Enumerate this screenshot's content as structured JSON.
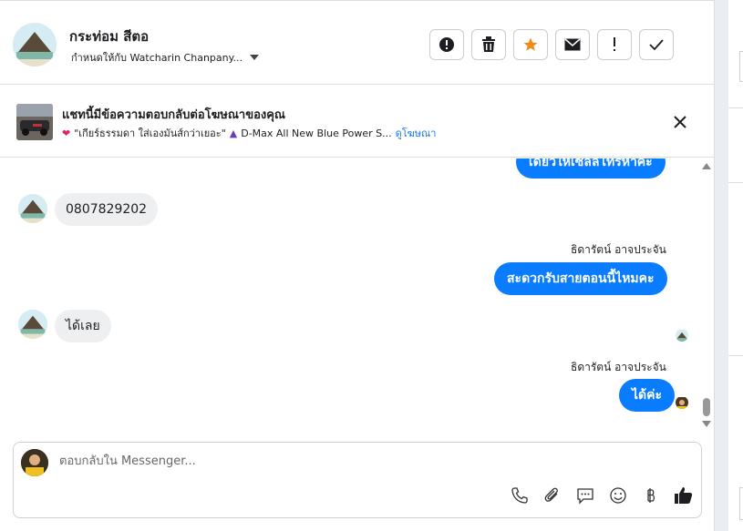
{
  "contact": {
    "name": "กระท่อม สีตอ",
    "assigned": "กำหนดให้กับ Watcharin Chanpany..."
  },
  "toolbar": {
    "buttons": [
      {
        "name": "spam-button",
        "icon": "alert-circle-icon"
      },
      {
        "name": "delete-button",
        "icon": "trash-icon"
      },
      {
        "name": "star-button",
        "icon": "star-icon",
        "color": "#f28a1b"
      },
      {
        "name": "mark-unread-button",
        "icon": "envelope-icon"
      },
      {
        "name": "follow-up-button",
        "icon": "exclamation-icon"
      },
      {
        "name": "done-button",
        "icon": "check-icon"
      }
    ]
  },
  "ad": {
    "title": "แชทนี้มีข้อความตอบกลับต่อโฆษณาของคุณ",
    "snippet": "\"เกียร์ธรรมดา ใส่เองมันส์กว่าเยอะ\"",
    "product": "D-Max All New Blue Power S...",
    "link": "ดูโฆษณา"
  },
  "messages": {
    "out_top": "เดี๋ยวให้เซลล์โทรหาคะ",
    "in_phone": "0807829202",
    "sender1": "ธิดารัตน์ อาจประจัน",
    "out_call": "สะดวกรับสายตอนนี้ไหมคะ",
    "in_ok": "ได้เลย",
    "sender2": "ธิดารัตน์ อาจประจัน",
    "out_ok": "ได้ค่ะ"
  },
  "composer": {
    "placeholder": "ตอบกลับใน Messenger..."
  },
  "colors": {
    "accent": "#0a7cff",
    "star": "#f28a1b",
    "link": "#1877f2"
  }
}
